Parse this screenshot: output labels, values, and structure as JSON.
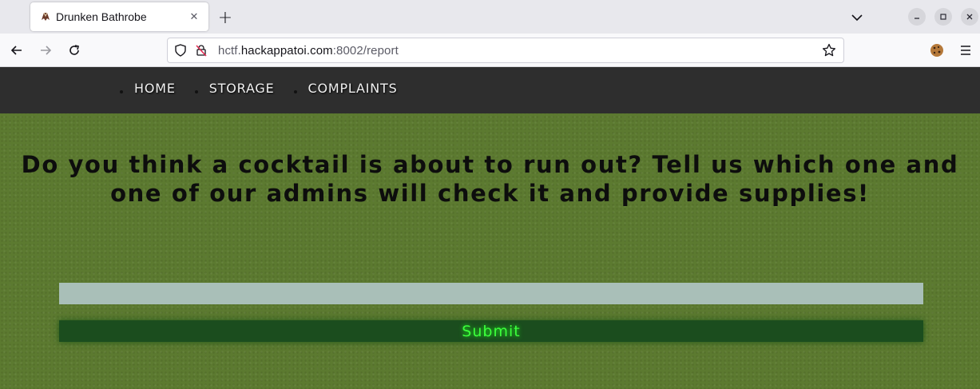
{
  "browser": {
    "tab": {
      "title": "Drunken Bathrobe",
      "favicon": "bathrobe-icon"
    },
    "new_tab_label": "+",
    "window_controls": [
      "minimize-icon",
      "maximize-icon",
      "close-icon"
    ],
    "url": {
      "prefix": "hctf.",
      "host": "hackappatoi.com",
      "suffix": ":8002/report"
    },
    "extensions": [
      "cookie-icon"
    ]
  },
  "site": {
    "nav": [
      {
        "label": "HOME"
      },
      {
        "label": "STORAGE"
      },
      {
        "label": "COMPLAINTS"
      }
    ],
    "headline": "Do you think a cocktail is about to run out? Tell us which one and one of our admins will check it and provide supplies!",
    "form": {
      "input_value": "",
      "input_placeholder": "",
      "submit_label": "Submit"
    }
  },
  "colors": {
    "page_background": "#5c7a30",
    "nav_background": "#2e2e2e",
    "input_background": "#a9bfb8",
    "submit_background": "#1b4d1e",
    "submit_text": "#3cff3c"
  }
}
